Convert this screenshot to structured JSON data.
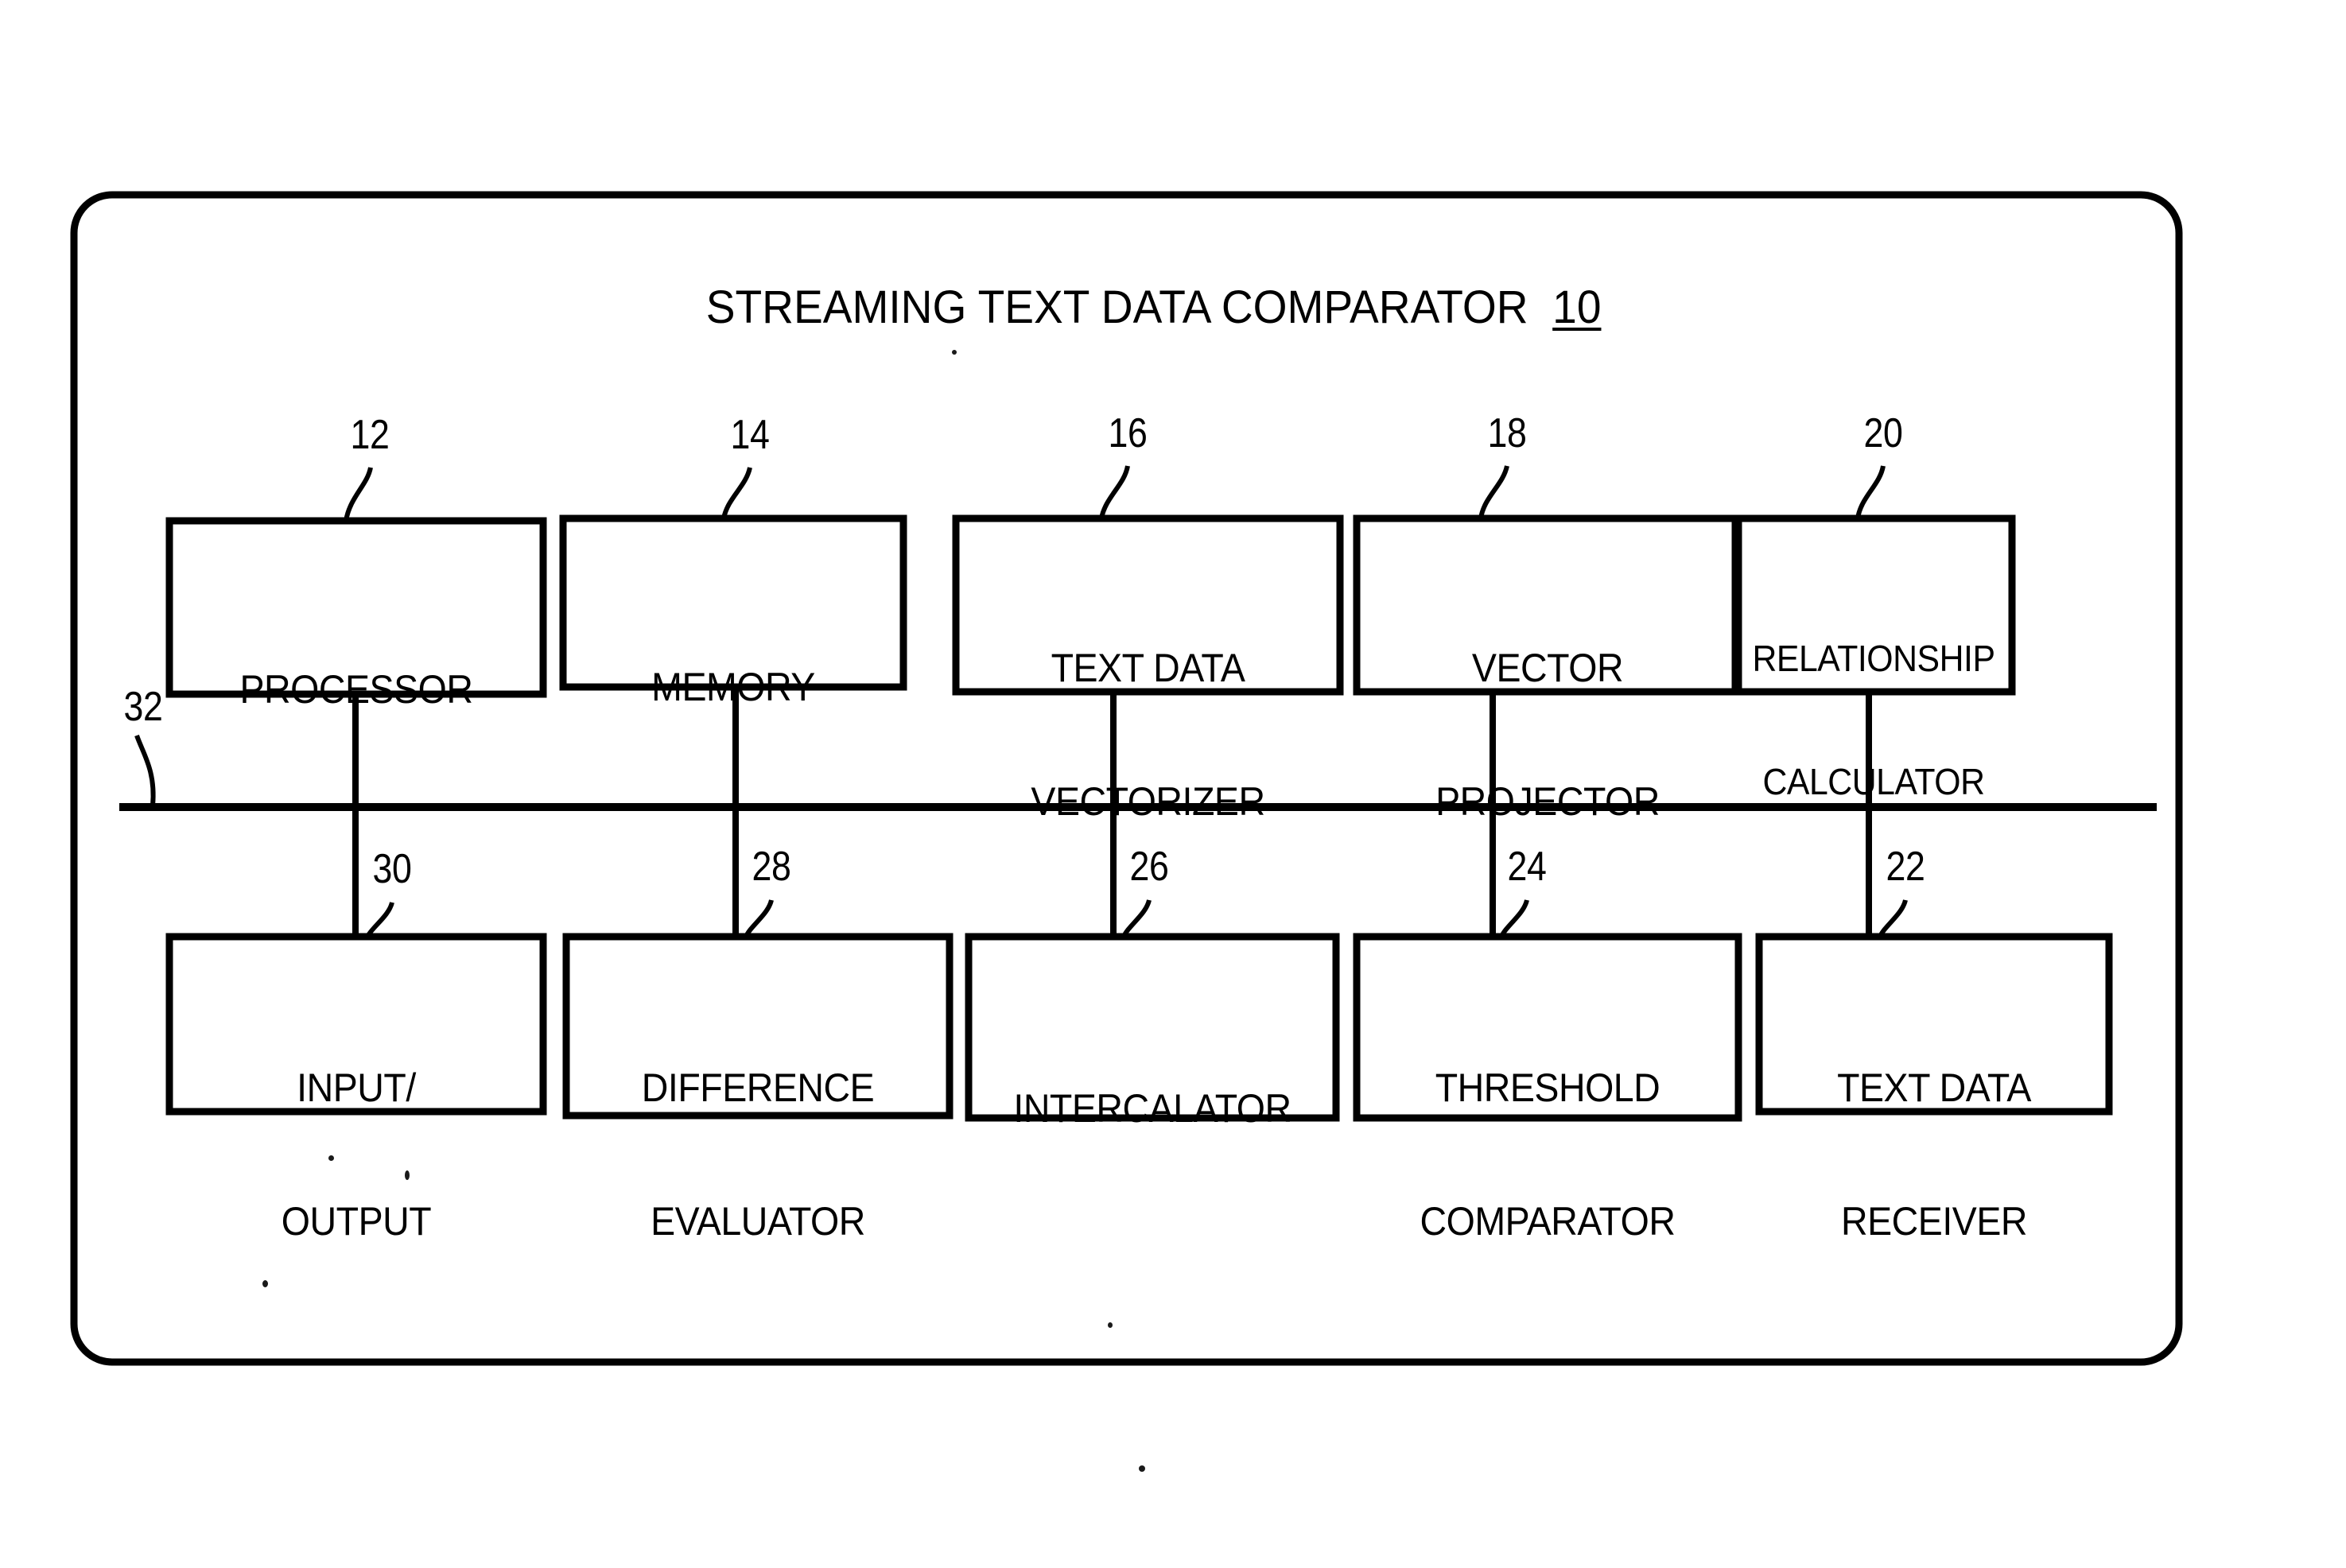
{
  "figure": {
    "title_text": "STREAMING TEXT DATA COMPARATOR",
    "title_ref": "10",
    "bus_ref": "32",
    "ink_color": "#000000",
    "background_color": "#ffffff"
  },
  "top_row": [
    {
      "label_line1": "PROCESSOR",
      "label_line2": "",
      "ref": "12"
    },
    {
      "label_line1": "MEMORY",
      "label_line2": "",
      "ref": "14"
    },
    {
      "label_line1": "TEXT DATA",
      "label_line2": "VECTORIZER",
      "ref": "16"
    },
    {
      "label_line1": "VECTOR",
      "label_line2": "PROJECTOR",
      "ref": "18"
    },
    {
      "label_line1": "RELATIONSHIP",
      "label_line2": "CALCULATOR",
      "ref": "20"
    }
  ],
  "bottom_row": [
    {
      "label_line1": "INPUT/",
      "label_line2": "OUTPUT",
      "ref": "30"
    },
    {
      "label_line1": "DIFFERENCE",
      "label_line2": "EVALUATOR",
      "ref": "28"
    },
    {
      "label_line1": "INTERCALATOR",
      "label_line2": "",
      "ref": "26"
    },
    {
      "label_line1": "THRESHOLD",
      "label_line2": "COMPARATOR",
      "ref": "24"
    },
    {
      "label_line1": "TEXT DATA",
      "label_line2": "RECEIVER",
      "ref": "22"
    }
  ]
}
